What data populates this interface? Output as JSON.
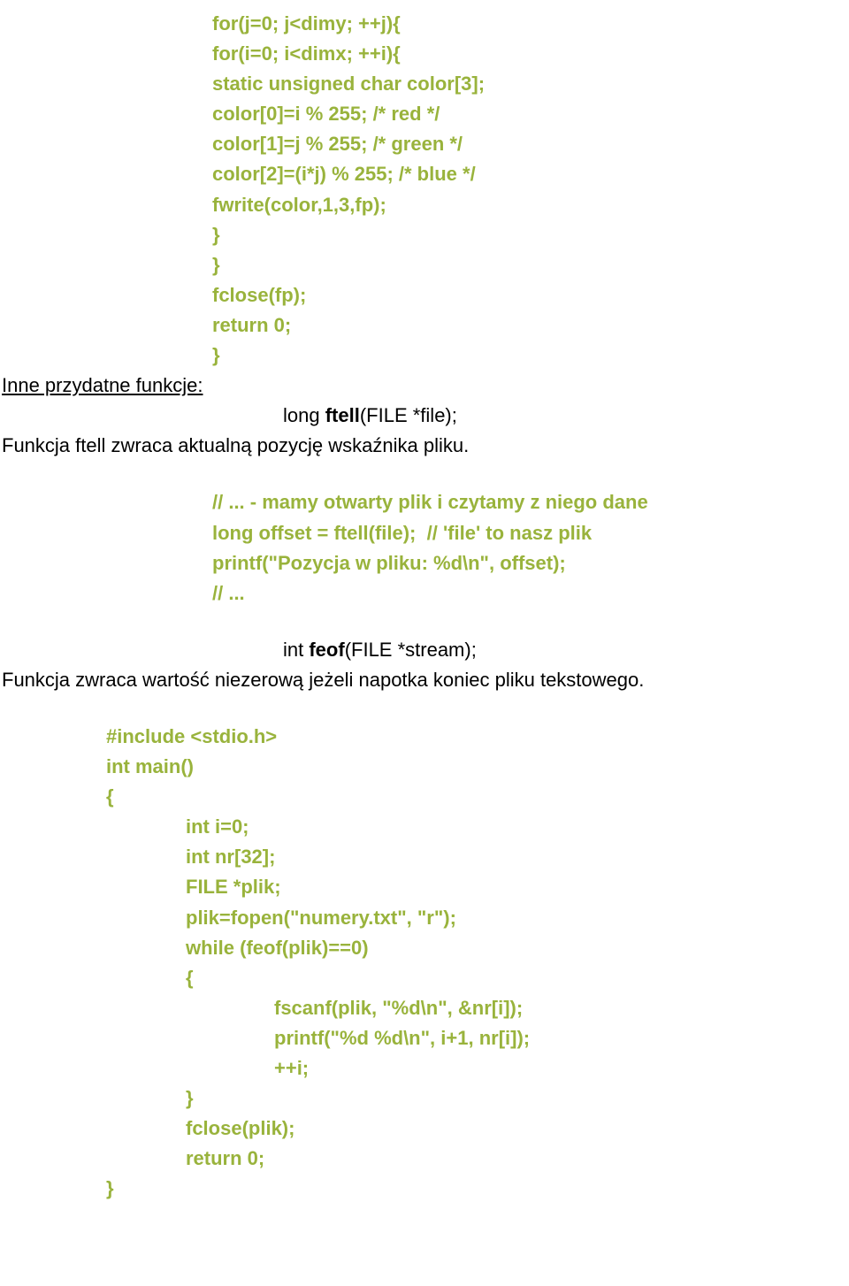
{
  "block1": {
    "l1": "for(j=0; j<dimy; ++j){",
    "l2": "for(i=0; i<dimx; ++i){",
    "l3": "static unsigned char color[3];",
    "l4": "color[0]=i % 255; /* red */",
    "l5": "color[1]=j % 255; /* green */",
    "l6": "color[2]=(i*j) % 255; /* blue */",
    "l7": "fwrite(color,1,3,fp);",
    "l8": "}",
    "l9": "}",
    "l10": "fclose(fp);",
    "l11": "return 0;",
    "l12": "}"
  },
  "section2": {
    "heading": "Inne przydatne funkcje:",
    "sig_pre": "long ",
    "sig_func": "ftell",
    "sig_post": "(FILE *file);",
    "desc": "Funkcja ftell zwraca aktualną pozycję wskaźnika pliku."
  },
  "block2": {
    "l1": "// ... - mamy otwarty plik i czytamy z niego dane",
    "l2": "long offset = ftell(file);  // 'file' to nasz plik",
    "l3": "printf(\"Pozycja w pliku: %d\\n\", offset);",
    "l4": "// ..."
  },
  "section3": {
    "sig_pre": "int ",
    "sig_func": "feof",
    "sig_post": "(FILE *stream);",
    "desc": "Funkcja zwraca wartość niezerową jeżeli napotka koniec pliku tekstowego."
  },
  "block3": {
    "l1": "#include <stdio.h>",
    "l2": "int main()",
    "l3": "{",
    "l4": "int i=0;",
    "l5": "int nr[32];",
    "l6": "FILE *plik;",
    "l7": "plik=fopen(\"numery.txt\", \"r\");",
    "l8": "while (feof(plik)==0)",
    "l9": "{",
    "l10": "fscanf(plik, \"%d\\n\", &nr[i]);",
    "l11": "printf(\"%d %d\\n\", i+1, nr[i]);",
    "l12": "++i;",
    "l13": "}",
    "l14": "fclose(plik);",
    "l15": "return 0;",
    "l16": "}"
  }
}
